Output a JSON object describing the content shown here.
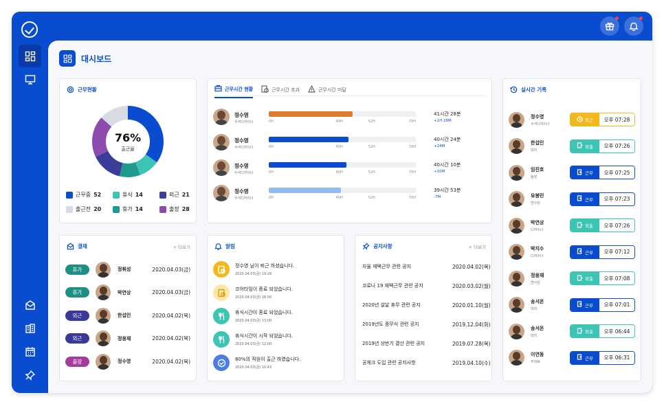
{
  "colors": {
    "primary": "#0a4ccf",
    "teal": "#3cc4b4",
    "light_blue": "#90bdf1",
    "orange": "#e07a2e",
    "gray": "#d7dbe3",
    "purple": "#8e4bae",
    "indigo": "#3a3d9a",
    "dark_teal": "#1e9a8e",
    "yellow": "#f2b81e",
    "green_pill": "#1e8f84",
    "purple_pill": "#3a3899",
    "magenta_pill": "#a53c9b"
  },
  "page": {
    "title": "대시보드"
  },
  "sidebar": {
    "icons": [
      "dashboard-icon",
      "monitor-icon",
      "approval-icon",
      "building-icon",
      "calendar-icon",
      "pin-icon"
    ]
  },
  "attendance": {
    "title": "근무현황",
    "percent": "76%",
    "label": "출근율",
    "legend": [
      {
        "label": "근무중",
        "value": "52",
        "color": "#0a4ccf",
        "count": 52
      },
      {
        "label": "휴식",
        "value": "14",
        "color": "#3cc4b4",
        "count": 14
      },
      {
        "label": "외근",
        "value": "21",
        "color": "#3a3d9a",
        "count": 21
      },
      {
        "label": "출근전",
        "value": "20",
        "color": "#d7dbe3",
        "count": 20
      },
      {
        "label": "휴가",
        "value": "14",
        "color": "#1e9a8e",
        "count": 14
      },
      {
        "label": "출장",
        "value": "28",
        "color": "#8e4bae",
        "count": 28
      }
    ]
  },
  "worktime": {
    "tabs": [
      "근무시간 현황",
      "근무시간 초과",
      "근무시간 미달"
    ],
    "ticks": [
      "0H",
      "40H",
      "52H",
      "70H"
    ],
    "rows": [
      {
        "name": "정수영",
        "role": "수석디자이너",
        "total": "41시간 28분",
        "diff": "+1H 28M",
        "fill_pct": 57,
        "color": "#e07a2e"
      },
      {
        "name": "정수영",
        "role": "수석디자이너",
        "total": "40시간 24분",
        "diff": "+24M",
        "fill_pct": 54,
        "color": "#0a4ccf"
      },
      {
        "name": "정수영",
        "role": "수석디자이너",
        "total": "40시간 10분",
        "diff": "+10M",
        "fill_pct": 53,
        "color": "#0a4ccf"
      },
      {
        "name": "정수영",
        "role": "수석디자이너",
        "total": "39시간 53분",
        "diff": "-7M",
        "fill_pct": 49,
        "color": "#90bdf1"
      }
    ]
  },
  "approval": {
    "title": "결재",
    "more": "+ 더보기",
    "rows": [
      {
        "type": "휴가",
        "color": "#1e8f84",
        "name": "정휘성",
        "date": "2020.04.03(금)"
      },
      {
        "type": "휴가",
        "color": "#1e8f84",
        "name": "박연상",
        "date": "2020.04.03(금)"
      },
      {
        "type": "외근",
        "color": "#3a3899",
        "name": "한섭인",
        "date": "2020.04.02(목)"
      },
      {
        "type": "외근",
        "color": "#3a3899",
        "name": "정웅재",
        "date": "2020.04.02(목)"
      },
      {
        "type": "출장",
        "color": "#a53c9b",
        "name": "정수영",
        "date": "2020.04.02(목)"
      }
    ]
  },
  "alerts": {
    "title": "알림",
    "rows": [
      {
        "msg": "정수영 님이 퇴근 하셨습니다.",
        "time": "2020.04.03(금) 19:28",
        "color": "#f2b81e",
        "icon": "clock-icon"
      },
      {
        "msg": "코어타임이 종료 되었습니다.",
        "time": "2020.04.03(금) 16:00",
        "color": "#fbe7a6",
        "icon": "clock-icon"
      },
      {
        "msg": "휴식시간이 종료 되었습니다.",
        "time": "2020.04.03(금) 13:00",
        "color": "#3cc4b4",
        "icon": "fork-knife-icon"
      },
      {
        "msg": "휴식시간이 시작 되었습니다.",
        "time": "2020.04.03(금) 12:00",
        "color": "#3cc4b4",
        "icon": "fork-knife-icon"
      },
      {
        "msg": "80%의 직원이 출근 하였습니다.",
        "time": "2020.04.03(금) 10:43",
        "color": "#4a7fe0",
        "icon": "check-circle-icon"
      }
    ]
  },
  "notices": {
    "title": "공지사항",
    "more": "+ 더보기",
    "rows": [
      {
        "title": "자율 재택근무 관련 공지",
        "date": "2020.04.02(목)"
      },
      {
        "title": "코로나 19 재택근무 관련 공지",
        "date": "2020.03.02(월)"
      },
      {
        "title": "2020년 설날 휴무 관련 공지",
        "date": "2020.01.10(월)"
      },
      {
        "title": "2019년도 종무식 관련 공지",
        "date": "2019.12.04(화)"
      },
      {
        "title": "2019년 상반기 결산 관련 공지",
        "date": "2019.07.28(목)"
      },
      {
        "title": "공체크 도입 관련 공지사항",
        "date": "2019.04.10(수)"
      }
    ]
  },
  "realtime": {
    "title": "실시간 기록",
    "rows": [
      {
        "name": "정수영",
        "role": "수석디자이너",
        "status": "퇴근",
        "color": "#f2b81e",
        "time": "오후 07:28"
      },
      {
        "name": "한섭인",
        "role": "대리",
        "status": "외출",
        "color": "#3cc4b4",
        "time": "오후 07:26"
      },
      {
        "name": "임진호",
        "role": "팀장",
        "status": "근무",
        "color": "#0a4ccf",
        "time": "오후 07:25"
      },
      {
        "name": "유봉민",
        "role": "연구원",
        "status": "근무",
        "color": "#0a4ccf",
        "time": "오후 07:23"
      },
      {
        "name": "박연상",
        "role": "디자이너",
        "status": "외출",
        "color": "#3cc4b4",
        "time": "오후 07:26"
      },
      {
        "name": "박지수",
        "role": "디자이너",
        "status": "근무",
        "color": "#0a4ccf",
        "time": "오후 07:12"
      },
      {
        "name": "정웅재",
        "role": "연구원",
        "status": "외출",
        "color": "#3cc4b4",
        "time": "오후 07:08"
      },
      {
        "name": "송서온",
        "role": "대리",
        "status": "근무",
        "color": "#0a4ccf",
        "time": "오후 07:01"
      },
      {
        "name": "송서온",
        "role": "대리",
        "status": "외출",
        "color": "#3cc4b4",
        "time": "오후 06:44"
      },
      {
        "name": "이연동",
        "role": "부대표",
        "status": "근무",
        "color": "#0a4ccf",
        "time": "오후 06:31"
      }
    ]
  }
}
